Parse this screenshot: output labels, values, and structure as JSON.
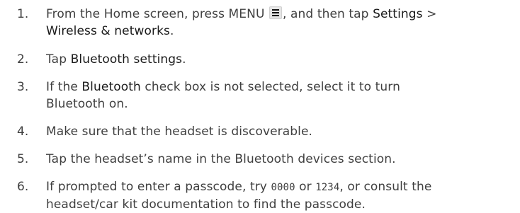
{
  "steps": [
    {
      "num": "1.",
      "line1_pre": "From the Home screen, press MENU",
      "icon": "menu-icon",
      "line1_mid": ", and then tap",
      "settings": "Settings",
      "sep": ">",
      "wireless": "Wireless & networks",
      "end": "."
    },
    {
      "num": "2.",
      "pre": "Tap",
      "bt_settings": "Bluetooth settings",
      "end": "."
    },
    {
      "num": "3.",
      "pre": "If the",
      "bluetooth": "Bluetooth",
      "post1": "check box is not selected, select it to turn",
      "line2": "Bluetooth on."
    },
    {
      "num": "4.",
      "text": "Make sure that the headset is discoverable."
    },
    {
      "num": "5.",
      "text": "Tap the headset’s name in the Bluetooth devices section."
    },
    {
      "num": "6.",
      "pre": "If prompted to enter a passcode, try",
      "code1": "0000",
      "or": "or",
      "code2": "1234",
      "post": ", or consult the",
      "line2": "headset/car kit documentation to find the passcode."
    }
  ]
}
